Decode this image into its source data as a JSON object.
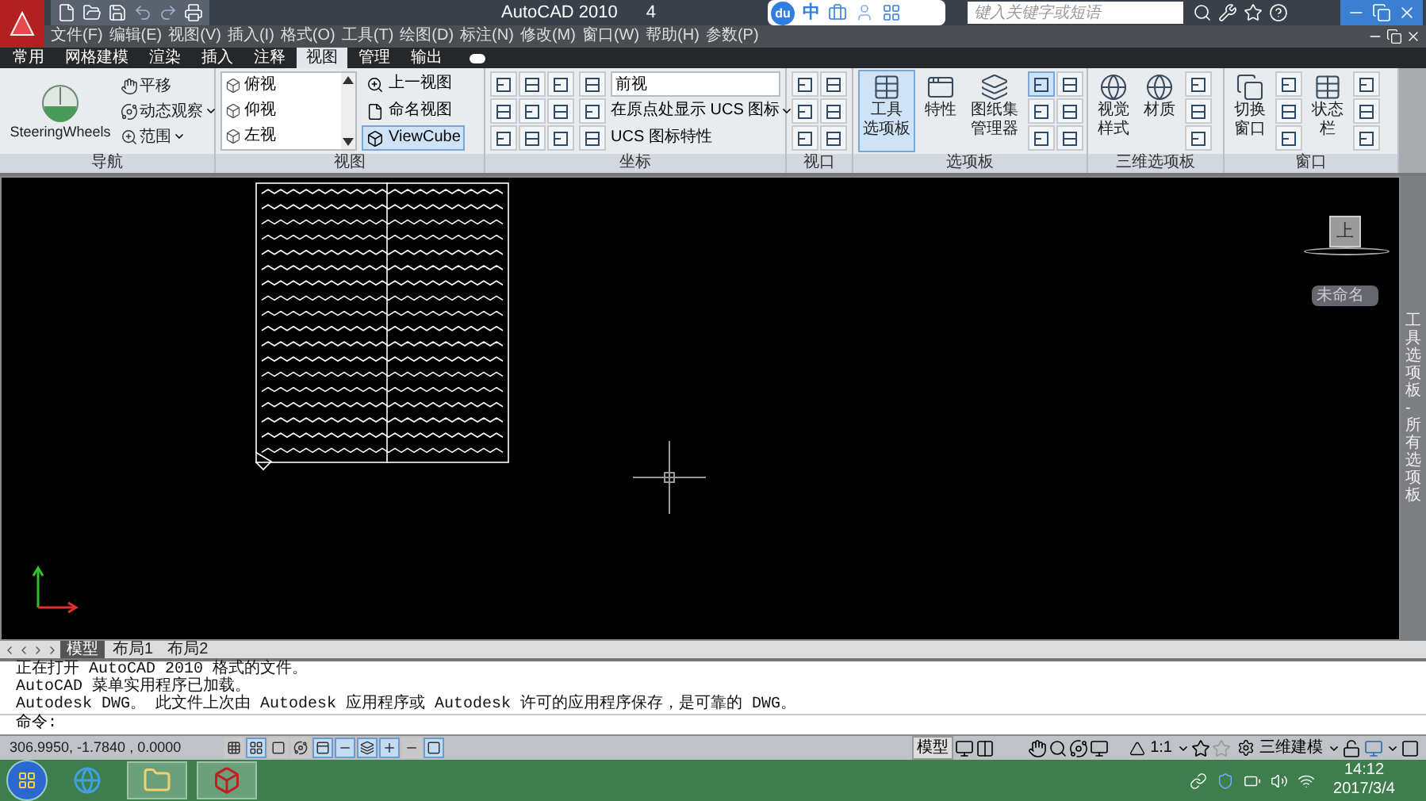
{
  "title_bar": {
    "title": "AutoCAD 2010",
    "document": "4",
    "search": {
      "placeholder": "键入关键字或短语"
    }
  },
  "ime_bar": {
    "logo": "du",
    "mode": "中"
  },
  "menu": [
    "文件(F)",
    "编辑(E)",
    "视图(V)",
    "插入(I)",
    "格式(O)",
    "工具(T)",
    "绘图(D)",
    "标注(N)",
    "修改(M)",
    "窗口(W)",
    "帮助(H)",
    "参数(P)"
  ],
  "ribbon_tabs": [
    {
      "label": "常用",
      "selected": false
    },
    {
      "label": "网格建模",
      "selected": false
    },
    {
      "label": "渲染",
      "selected": false
    },
    {
      "label": "插入",
      "selected": false
    },
    {
      "label": "注释",
      "selected": false
    },
    {
      "label": "视图",
      "selected": true
    },
    {
      "label": "管理",
      "selected": false
    },
    {
      "label": "输出",
      "selected": false
    }
  ],
  "panels": {
    "navigation": {
      "title": "导航",
      "wheel": "SteeringWheels",
      "tools": [
        "平移",
        "动态观察",
        "范围"
      ]
    },
    "views": {
      "title": "视图",
      "list": [
        "俯视",
        "仰视",
        "左视"
      ],
      "buttons": [
        {
          "label": "上一视图",
          "selected": false
        },
        {
          "label": "命名视图",
          "selected": false
        },
        {
          "label": "ViewCube",
          "selected": true
        }
      ]
    },
    "coordinates": {
      "title": "坐标",
      "view_dropdown": "前视",
      "show_ucs": "在原点处显示 UCS 图标",
      "ucs_properties": "UCS 图标特性"
    },
    "viewports": {
      "title": "视口"
    },
    "palettes": {
      "title": "选项板",
      "buttons": [
        {
          "lines": [
            "工具",
            "选项板"
          ],
          "selected": true
        },
        {
          "lines": [
            "特性"
          ],
          "selected": false
        },
        {
          "lines": [
            "图纸集",
            "管理器"
          ],
          "selected": false
        }
      ]
    },
    "palettes_3d": {
      "title": "三维选项板",
      "buttons": [
        {
          "lines": [
            "视觉",
            "样式"
          ]
        },
        {
          "lines": [
            "材质"
          ]
        }
      ]
    },
    "window": {
      "title": "窗口",
      "switch": [
        "切换",
        "窗口"
      ],
      "status_bar": [
        "状态",
        "栏"
      ]
    }
  },
  "canvas": {
    "viewcube": "上",
    "view_name": "未命名",
    "palette_title": "工具选项板 - 所有选项板"
  },
  "layout_tabs": [
    {
      "label": "模型",
      "selected": true
    },
    {
      "label": "布局1",
      "selected": false
    },
    {
      "label": "布局2",
      "selected": false
    }
  ],
  "command_history": [
    "正在打开 AutoCAD 2010 格式的文件。",
    "AutoCAD 菜单实用程序已加载。",
    "Autodesk DWG。  此文件上次由 Autodesk 应用程序或 Autodesk 许可的应用程序保存，是可靠的 DWG。"
  ],
  "command_prompt": "命令:",
  "status_bar": {
    "coordinates": "306.9950, -1.7840 , 0.0000",
    "toggles": [
      {
        "on": false
      },
      {
        "on": true
      },
      {
        "on": false
      },
      {
        "on": false
      },
      {
        "on": true
      },
      {
        "on": true
      },
      {
        "on": true
      },
      {
        "on": true
      },
      {
        "on": false
      },
      {
        "on": true
      }
    ],
    "model": "模型",
    "scale": "1:1",
    "workspace": "三维建模"
  },
  "taskbar": {
    "apps": [
      {
        "kind": "browser"
      },
      {
        "kind": "folder"
      },
      {
        "kind": "cad"
      }
    ],
    "time": "14:12",
    "date": "2017/3/4"
  }
}
